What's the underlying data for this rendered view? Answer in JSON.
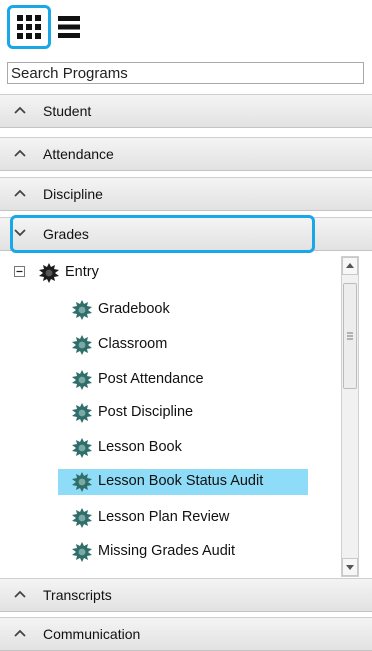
{
  "search": {
    "placeholder": "Search Programs"
  },
  "sections_top": [
    {
      "label": "Student",
      "expanded": false
    },
    {
      "label": "Attendance",
      "expanded": false
    },
    {
      "label": "Discipline",
      "expanded": false
    },
    {
      "label": "Grades",
      "expanded": true
    }
  ],
  "tree": {
    "root_label": "Entry",
    "items": [
      {
        "label": "Gradebook"
      },
      {
        "label": "Classroom"
      },
      {
        "label": "Post Attendance"
      },
      {
        "label": "Post Discipline"
      },
      {
        "label": "Lesson Book"
      },
      {
        "label": "Lesson Book Status Audit",
        "selected": true
      },
      {
        "label": "Lesson Plan Review"
      },
      {
        "label": "Missing Grades Audit"
      }
    ]
  },
  "sections_bottom": [
    {
      "label": "Transcripts",
      "expanded": false
    },
    {
      "label": "Communication",
      "expanded": false
    }
  ],
  "colors": {
    "highlight_border": "#1aa7e8",
    "selected_row": "#8fdcf8"
  },
  "icons": {
    "grid": "grid-icon",
    "list": "hamburger-list-icon",
    "collapsed": "chevron-up-icon",
    "expanded": "chevron-down-icon",
    "tree_toggle": "minus-box-icon",
    "program": "gear-icon"
  }
}
